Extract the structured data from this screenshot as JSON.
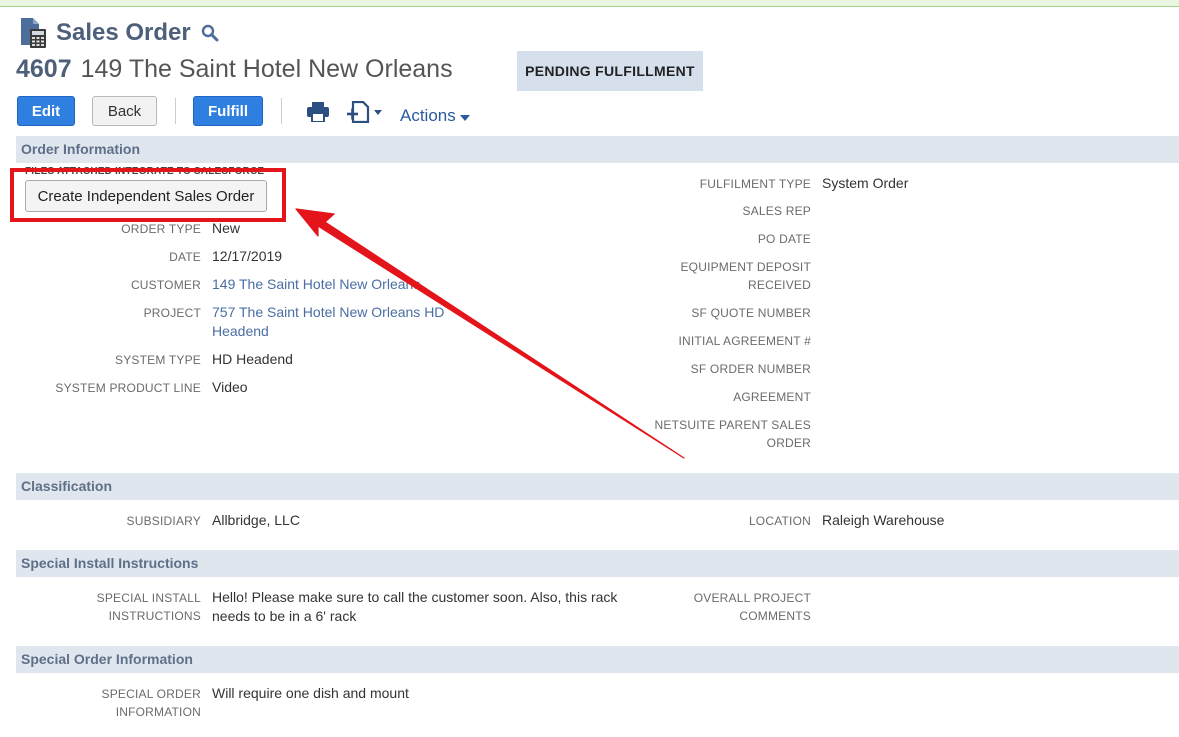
{
  "header": {
    "page_title": "Sales Order",
    "record_number": "4607",
    "record_name": "149 The Saint Hotel New Orleans",
    "status": "PENDING FULFILLMENT"
  },
  "toolbar": {
    "edit_label": "Edit",
    "back_label": "Back",
    "fulfill_label": "Fulfill",
    "actions_label": "Actions"
  },
  "sections": {
    "order_information": "Order Information",
    "classification": "Classification",
    "special_install": "Special Install Instructions",
    "special_order": "Special Order Information"
  },
  "order_info": {
    "files_attached": "FILES ATTACHED INTEGRATE TO SALESFORCE",
    "create_independent_label": "Create Independent Sales Order",
    "left": [
      {
        "label": "ORDER TYPE",
        "value": "New"
      },
      {
        "label": "DATE",
        "value": "12/17/2019"
      },
      {
        "label": "CUSTOMER",
        "value": "149 The Saint Hotel New Orleans"
      },
      {
        "label": "PROJECT",
        "value": "757 The Saint Hotel New Orleans HD Headend"
      },
      {
        "label": "SYSTEM TYPE",
        "value": "HD Headend"
      },
      {
        "label": "SYSTEM PRODUCT LINE",
        "value": "Video"
      }
    ],
    "right": [
      {
        "label": "FULFILMENT TYPE",
        "value": "System Order"
      },
      {
        "label": "SALES REP",
        "value": ""
      },
      {
        "label": "PO DATE",
        "value": ""
      },
      {
        "label": "EQUIPMENT DEPOSIT RECEIVED",
        "value": ""
      },
      {
        "label": "SF QUOTE NUMBER",
        "value": ""
      },
      {
        "label": "INITIAL AGREEMENT #",
        "value": ""
      },
      {
        "label": "SF ORDER NUMBER",
        "value": ""
      },
      {
        "label": "AGREEMENT",
        "value": ""
      },
      {
        "label": "NETSUITE PARENT SALES ORDER",
        "value": ""
      }
    ]
  },
  "classification": {
    "subsidiary_label": "SUBSIDIARY",
    "subsidiary_value": "Allbridge, LLC",
    "location_label": "LOCATION",
    "location_value": "Raleigh Warehouse"
  },
  "special_install": {
    "instructions_label": "SPECIAL INSTALL INSTRUCTIONS",
    "instructions_value": "Hello! Please make sure to call the customer soon. Also, this rack needs to be in a 6' rack",
    "comments_label": "OVERALL PROJECT COMMENTS"
  },
  "special_order": {
    "info_label": "SPECIAL ORDER INFORMATION",
    "info_value": "Will require one dish and mount"
  },
  "colors": {
    "button_blue": "#2f7fe0",
    "section_bg": "#dfe6ee",
    "title_blue": "#4d5f79",
    "link_blue": "#4a6ea3",
    "annotation_red": "#e4141b"
  }
}
